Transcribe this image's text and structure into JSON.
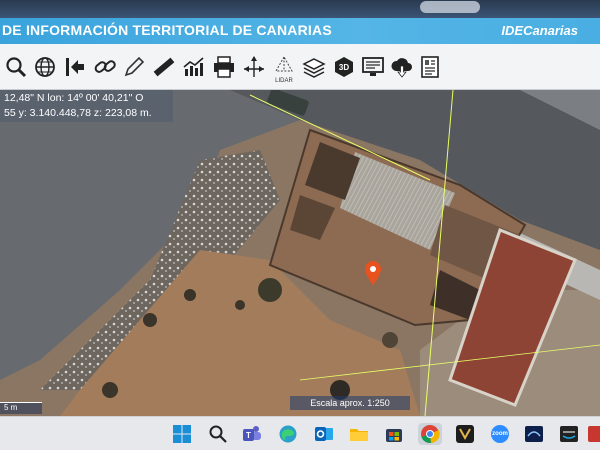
{
  "window": {
    "title": "DE INFORMACIÓN TERRITORIAL DE CANARIAS",
    "brand": "IDECanarias"
  },
  "toolbar": {
    "tools": [
      {
        "name": "zoom-icon"
      },
      {
        "name": "globe-icon"
      },
      {
        "name": "exit-icon"
      },
      {
        "name": "link-icon"
      },
      {
        "name": "pencil-icon"
      },
      {
        "name": "ruler-icon"
      },
      {
        "name": "profile-chart-icon"
      },
      {
        "name": "print-icon"
      },
      {
        "name": "coordinates-icon"
      },
      {
        "name": "lidar-icon",
        "label": "LIDAR"
      },
      {
        "name": "layers-icon"
      },
      {
        "name": "3d-icon"
      },
      {
        "name": "screen-icon"
      },
      {
        "name": "download-icon"
      },
      {
        "name": "document-icon"
      }
    ]
  },
  "map": {
    "coords_line1": "12,48\" N  lon: 14º 00' 40,21\" O",
    "coords_line2": "55  y: 3.140.448,78  z: 223,08 m.",
    "scale_bar_label": "5 m",
    "scale_text": "Escala aprox. 1:250",
    "marker_color": "#e8521f"
  },
  "taskbar": {
    "items": [
      {
        "name": "start-icon"
      },
      {
        "name": "search-icon"
      },
      {
        "name": "teams-icon"
      },
      {
        "name": "edge-icon"
      },
      {
        "name": "outlook-icon"
      },
      {
        "name": "file-explorer-icon"
      },
      {
        "name": "store-icon"
      },
      {
        "name": "chrome-icon",
        "active": true
      },
      {
        "name": "app-icon"
      },
      {
        "name": "zoom-app-icon",
        "label": "zoom"
      },
      {
        "name": "disney-icon"
      },
      {
        "name": "prime-video-icon"
      },
      {
        "name": "app-icon-2"
      }
    ]
  }
}
